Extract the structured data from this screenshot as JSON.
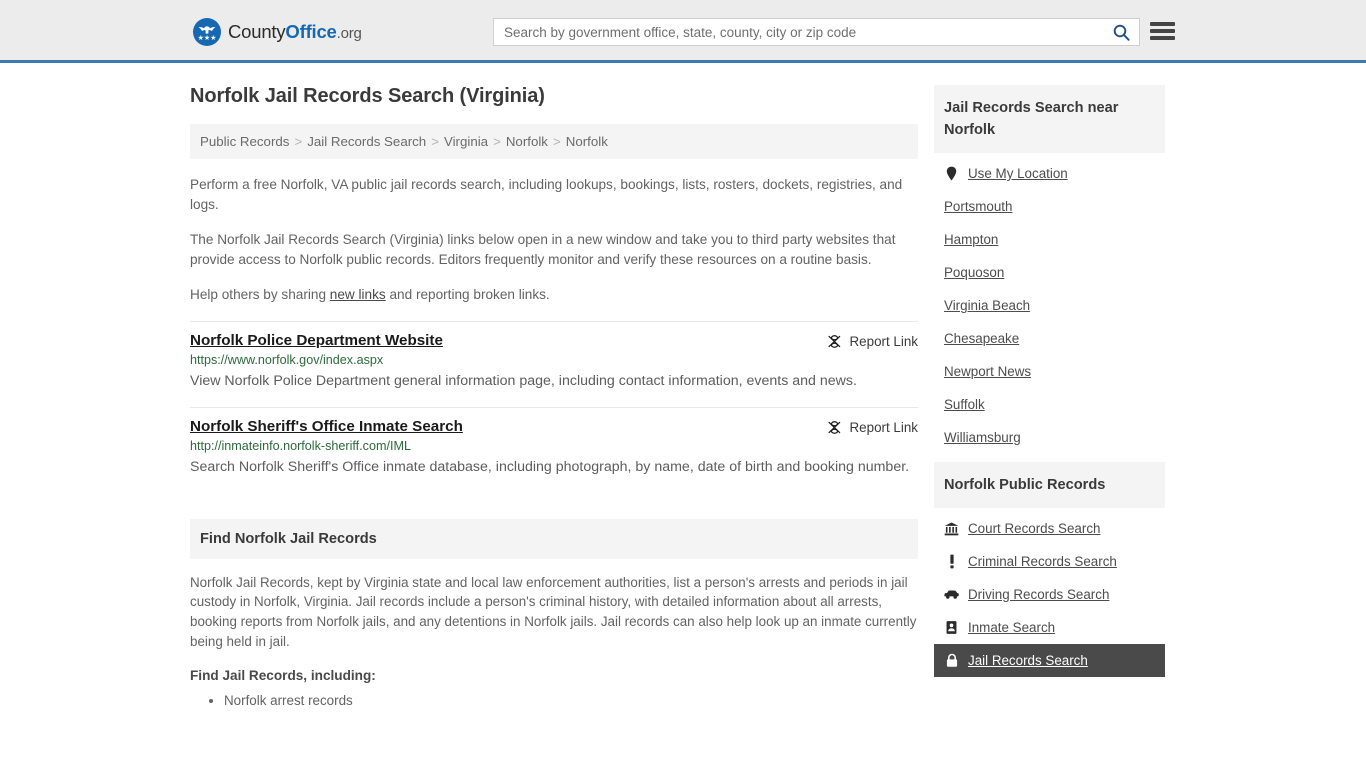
{
  "header": {
    "logo": {
      "part1": "County",
      "part2": "Office",
      "part3": ".org",
      "icon": "eagle-seal-icon"
    },
    "search": {
      "placeholder": "Search by government office, state, county, city or zip code",
      "value": "",
      "button_icon": "search-icon"
    },
    "menu_icon": "hamburger-menu-icon",
    "accent_color": "#3d7ab0",
    "background_color": "#ececec"
  },
  "page": {
    "title": "Norfolk Jail Records Search (Virginia)"
  },
  "breadcrumb": {
    "separator": ">",
    "items": [
      {
        "label": "Public Records"
      },
      {
        "label": "Jail Records Search"
      },
      {
        "label": "Virginia"
      },
      {
        "label": "Norfolk"
      },
      {
        "label": "Norfolk"
      }
    ]
  },
  "intro": {
    "p1": "Perform a free Norfolk, VA public jail records search, including lookups, bookings, lists, rosters, dockets, registries, and logs.",
    "p2": "The Norfolk Jail Records Search (Virginia) links below open in a new window and take you to third party websites that provide access to Norfolk public records. Editors frequently monitor and verify these resources on a routine basis.",
    "p3_before": "Help others by sharing ",
    "p3_link": "new links",
    "p3_after": " and reporting broken links."
  },
  "results": {
    "report_label": "Report Link",
    "report_icon": "broken-link-icon",
    "items": [
      {
        "title": "Norfolk Police Department Website",
        "url": "https://www.norfolk.gov/index.aspx",
        "description": "View Norfolk Police Department general information page, including contact information, events and news."
      },
      {
        "title": "Norfolk Sheriff's Office Inmate Search",
        "url": "http://inmateinfo.norfolk-sheriff.com/IML",
        "description": "Search Norfolk Sheriff's Office inmate database, including photograph, by name, date of birth and booking number."
      }
    ]
  },
  "find_section": {
    "heading": "Find Norfolk Jail Records",
    "paragraph": "Norfolk Jail Records, kept by Virginia state and local law enforcement authorities, list a person's arrests and periods in jail custody in Norfolk, Virginia. Jail records include a person's criminal history, with detailed information about all arrests, booking reports from Norfolk jails, and any detentions in Norfolk jails. Jail records can also help look up an inmate currently being held in jail.",
    "subheading": "Find Jail Records, including:",
    "bullets": [
      "Norfolk arrest records"
    ]
  },
  "sidebar": {
    "nearby": {
      "heading": "Jail Records Search near Norfolk",
      "items": [
        {
          "label": "Use My Location",
          "icon": "map-pin-icon"
        },
        {
          "label": "Portsmouth",
          "icon": ""
        },
        {
          "label": "Hampton",
          "icon": ""
        },
        {
          "label": "Poquoson",
          "icon": ""
        },
        {
          "label": "Virginia Beach",
          "icon": ""
        },
        {
          "label": "Chesapeake",
          "icon": ""
        },
        {
          "label": "Newport News",
          "icon": ""
        },
        {
          "label": "Suffolk",
          "icon": ""
        },
        {
          "label": "Williamsburg",
          "icon": ""
        }
      ]
    },
    "public_records": {
      "heading": "Norfolk Public Records",
      "active_color": "#4a4a4a",
      "items": [
        {
          "label": "Court Records Search",
          "icon": "courthouse-icon",
          "active": false
        },
        {
          "label": "Criminal Records Search",
          "icon": "exclamation-icon",
          "active": false
        },
        {
          "label": "Driving Records Search",
          "icon": "car-icon",
          "active": false
        },
        {
          "label": "Inmate Search",
          "icon": "id-card-icon",
          "active": false
        },
        {
          "label": "Jail Records Search",
          "icon": "lock-icon",
          "active": true
        }
      ]
    }
  }
}
